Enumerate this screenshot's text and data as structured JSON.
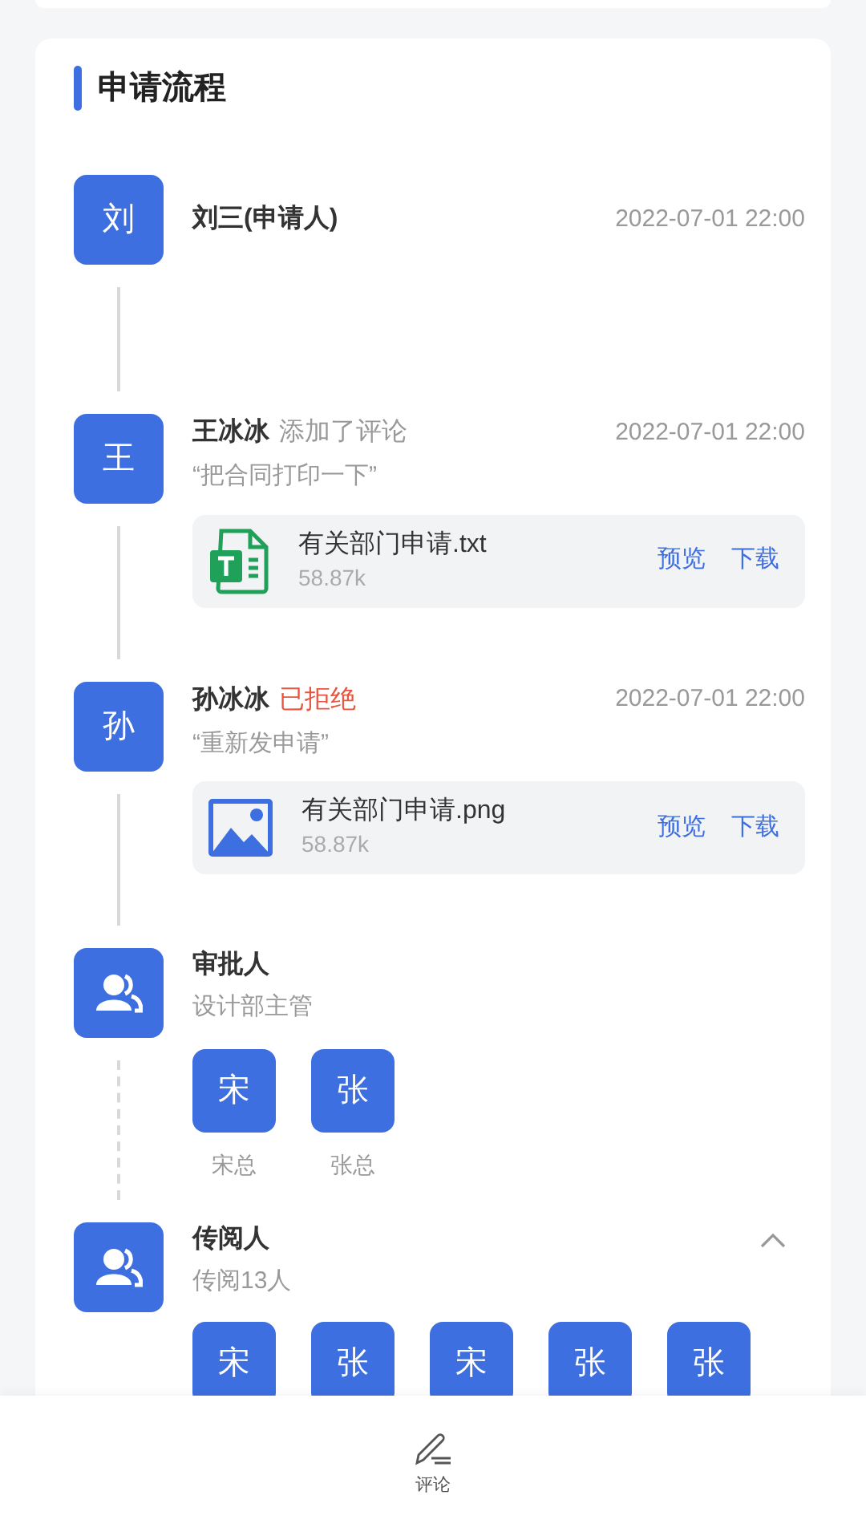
{
  "title": "申请流程",
  "steps": [
    {
      "kind": "person",
      "avatar": "刘",
      "name": "刘三(申请人)",
      "time": "2022-07-01 22:00",
      "connector": {
        "kind": "solid"
      }
    },
    {
      "kind": "person",
      "avatar": "王",
      "name": "王冰冰",
      "action": "添加了评论",
      "time": "2022-07-01 22:00",
      "comment": "“把合同打印一下”",
      "file": {
        "kind": "text",
        "name": "有关部门申请.txt",
        "size": "58.87k",
        "actions": [
          "预览",
          "下载"
        ]
      },
      "connector": {
        "kind": "solid"
      }
    },
    {
      "kind": "person",
      "avatar": "孙",
      "name": "孙冰冰",
      "status": "已拒绝",
      "time": "2022-07-01 22:00",
      "comment": "“重新发申请”",
      "file": {
        "kind": "image",
        "name": "有关部门申请.png",
        "size": "58.87k",
        "actions": [
          "预览",
          "下载"
        ]
      },
      "connector": {
        "kind": "solid"
      }
    },
    {
      "kind": "group",
      "name": "审批人",
      "subtitle": "设计部主管",
      "people": [
        {
          "avatar": "宋",
          "name": "宋总"
        },
        {
          "avatar": "张",
          "name": "张总"
        }
      ],
      "connector": {
        "kind": "dashed"
      }
    },
    {
      "kind": "group",
      "name": "传阅人",
      "subtitle": "传阅13人",
      "expanded": true,
      "people": [
        {
          "avatar": "宋"
        },
        {
          "avatar": "张"
        },
        {
          "avatar": "宋"
        },
        {
          "avatar": "张"
        },
        {
          "avatar": "张"
        }
      ]
    }
  ],
  "bottom_bar": {
    "label": "评论"
  }
}
